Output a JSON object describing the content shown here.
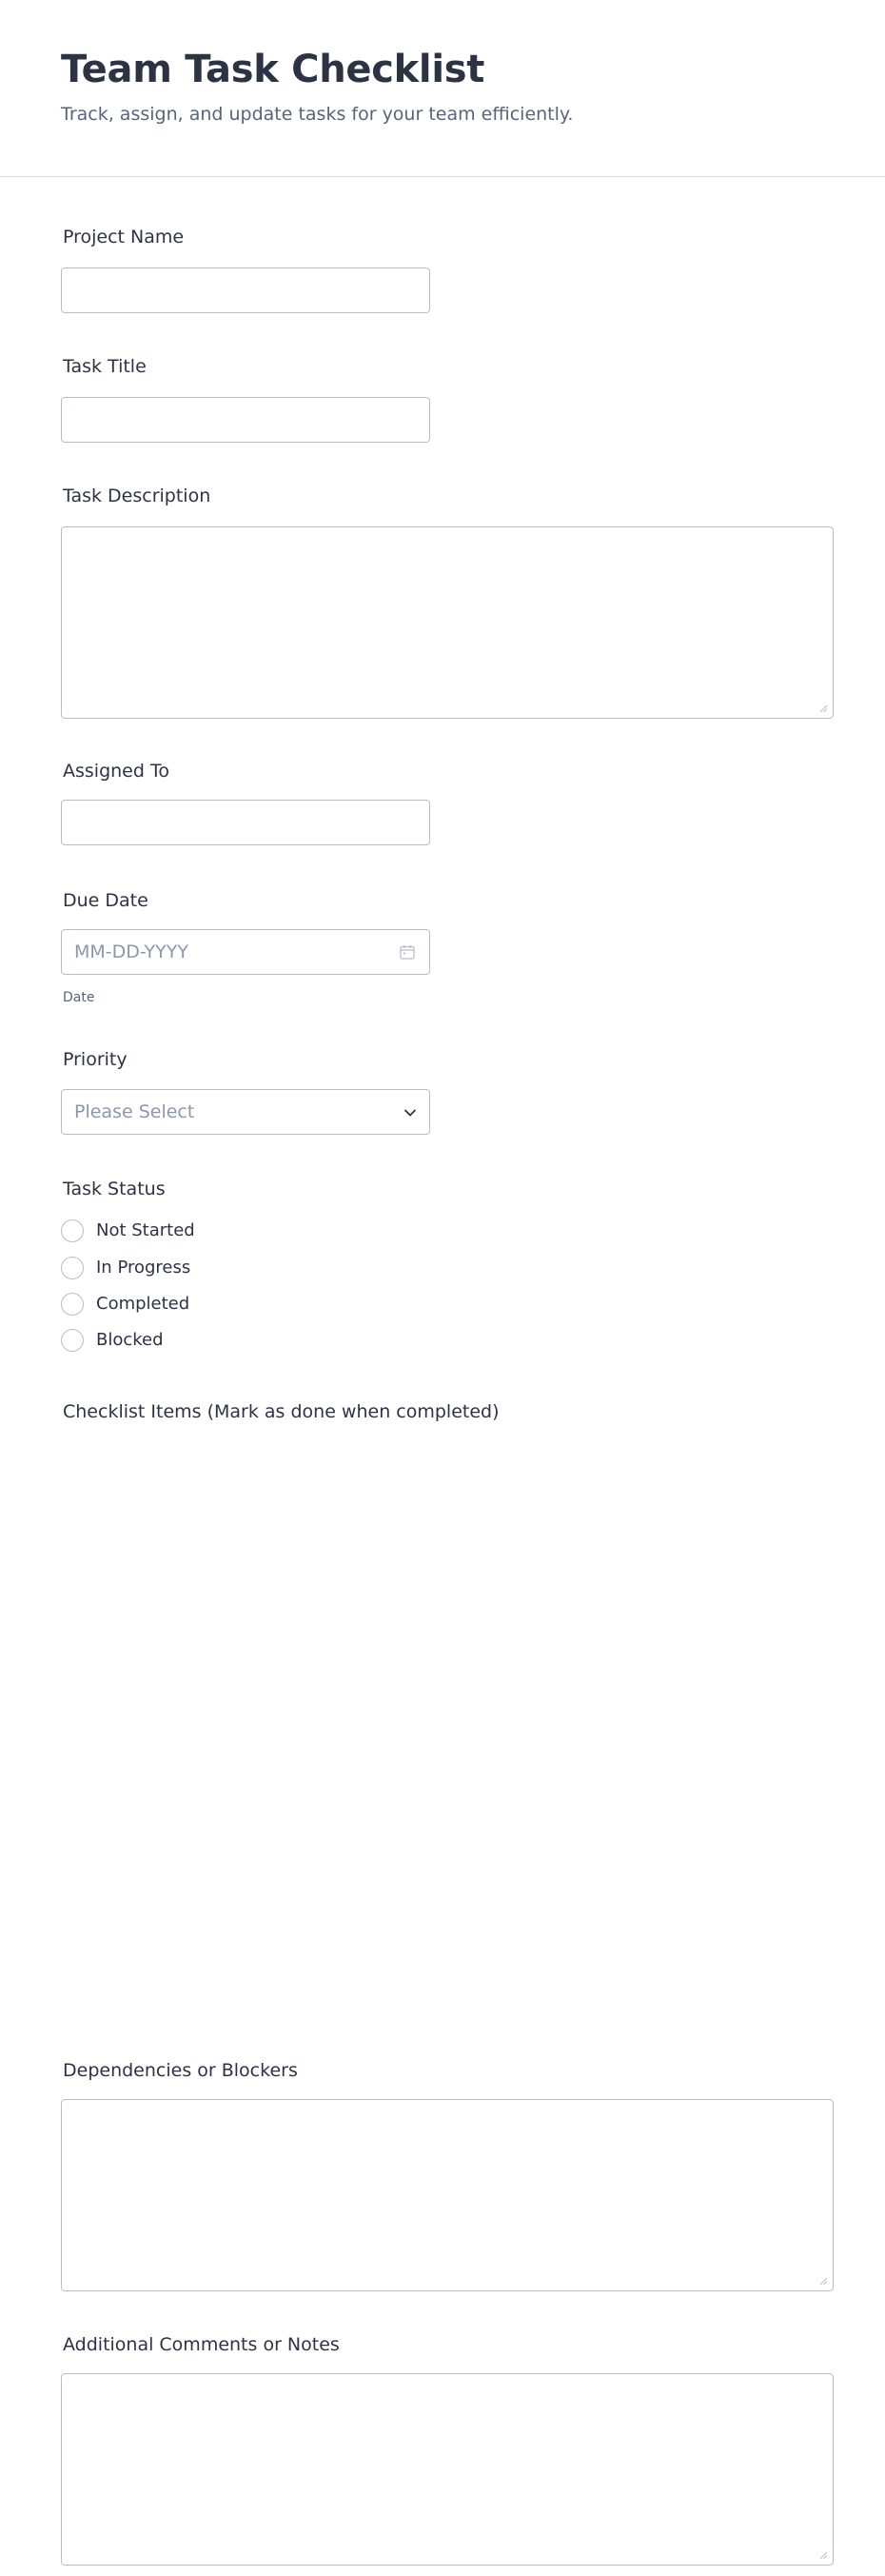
{
  "header": {
    "title": "Team Task Checklist",
    "subtitle": "Track, assign, and update tasks for your team efficiently."
  },
  "form": {
    "project_name": {
      "label": "Project Name",
      "value": ""
    },
    "task_title": {
      "label": "Task Title",
      "value": ""
    },
    "task_description": {
      "label": "Task Description",
      "value": ""
    },
    "assigned_to": {
      "label": "Assigned To",
      "value": ""
    },
    "due_date": {
      "label": "Due Date",
      "placeholder": "MM-DD-YYYY",
      "sublabel": "Date",
      "icon": "calendar-icon"
    },
    "priority": {
      "label": "Priority",
      "selected": "Please Select",
      "icon": "chevron-down-icon"
    },
    "task_status": {
      "label": "Task Status",
      "options": [
        "Not Started",
        "In Progress",
        "Completed",
        "Blocked"
      ]
    },
    "checklist_items": {
      "label": "Checklist Items (Mark as done when completed)"
    },
    "dependencies": {
      "label": "Dependencies or Blockers",
      "value": ""
    },
    "comments": {
      "label": "Additional Comments or Notes",
      "value": ""
    }
  },
  "colors": {
    "text": "#2c3345",
    "subtext": "#57647e",
    "placeholder": "#8d97ab",
    "border": "#b8bdc9",
    "divider": "#d8dae9"
  }
}
